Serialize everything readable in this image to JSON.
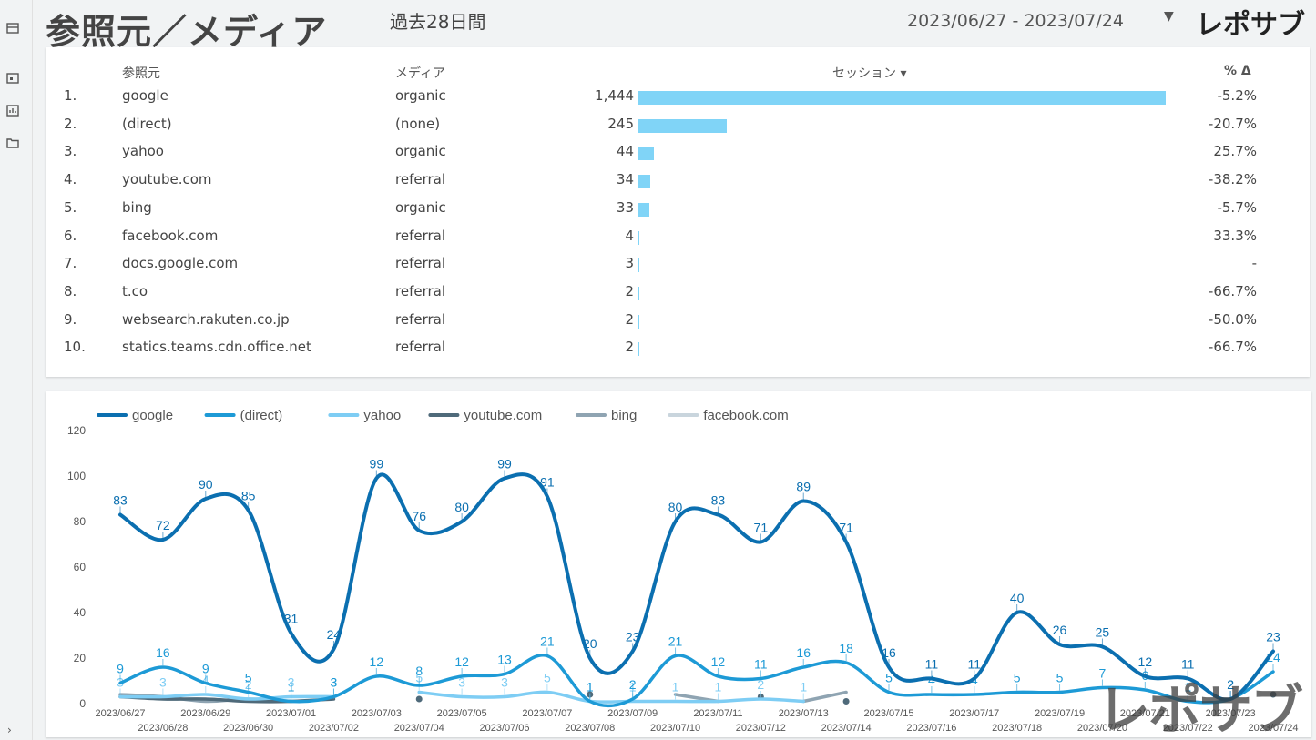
{
  "header": {
    "title": "参照元／メディア",
    "period_label": "過去28日間",
    "date_range": "2023/06/27 - 2023/07/24",
    "brand": "レポサブ"
  },
  "table": {
    "headers": {
      "source": "参照元",
      "medium": "メディア",
      "sessions": "セッション ▾",
      "pct": "% Δ"
    },
    "bar_color": "#80d4f7",
    "max_sessions": 1444,
    "rows": [
      {
        "idx": "1.",
        "source": "google",
        "medium": "organic",
        "sessions": 1444,
        "sessions_label": "1,444",
        "pct": "-5.2%"
      },
      {
        "idx": "2.",
        "source": "(direct)",
        "medium": "(none)",
        "sessions": 245,
        "sessions_label": "245",
        "pct": "-20.7%"
      },
      {
        "idx": "3.",
        "source": "yahoo",
        "medium": "organic",
        "sessions": 44,
        "sessions_label": "44",
        "pct": "25.7%"
      },
      {
        "idx": "4.",
        "source": "youtube.com",
        "medium": "referral",
        "sessions": 34,
        "sessions_label": "34",
        "pct": "-38.2%"
      },
      {
        "idx": "5.",
        "source": "bing",
        "medium": "organic",
        "sessions": 33,
        "sessions_label": "33",
        "pct": "-5.7%"
      },
      {
        "idx": "6.",
        "source": "facebook.com",
        "medium": "referral",
        "sessions": 4,
        "sessions_label": "4",
        "pct": "33.3%"
      },
      {
        "idx": "7.",
        "source": "docs.google.com",
        "medium": "referral",
        "sessions": 3,
        "sessions_label": "3",
        "pct": "-"
      },
      {
        "idx": "8.",
        "source": "t.co",
        "medium": "referral",
        "sessions": 2,
        "sessions_label": "2",
        "pct": "-66.7%"
      },
      {
        "idx": "9.",
        "source": "websearch.rakuten.co.jp",
        "medium": "referral",
        "sessions": 2,
        "sessions_label": "2",
        "pct": "-50.0%"
      },
      {
        "idx": "10.",
        "source": "statics.teams.cdn.office.net",
        "medium": "referral",
        "sessions": 2,
        "sessions_label": "2",
        "pct": "-66.7%"
      }
    ]
  },
  "watermark": "レポサブ",
  "chart_data": {
    "type": "line",
    "x": [
      "2023/06/27",
      "2023/06/28",
      "2023/06/29",
      "2023/06/30",
      "2023/07/01",
      "2023/07/02",
      "2023/07/03",
      "2023/07/04",
      "2023/07/05",
      "2023/07/06",
      "2023/07/07",
      "2023/07/08",
      "2023/07/09",
      "2023/07/10",
      "2023/07/11",
      "2023/07/12",
      "2023/07/13",
      "2023/07/14",
      "2023/07/15",
      "2023/07/16",
      "2023/07/17",
      "2023/07/18",
      "2023/07/19",
      "2023/07/20",
      "2023/07/21",
      "2023/07/22",
      "2023/07/23",
      "2023/07/24"
    ],
    "ylim": [
      0,
      120
    ],
    "yticks": [
      0,
      20,
      40,
      60,
      80,
      100,
      120
    ],
    "grid": false,
    "legend": "top-left",
    "series": [
      {
        "name": "google",
        "color": "#0b6fb0",
        "labels": true,
        "values": [
          83,
          72,
          90,
          85,
          31,
          24,
          99,
          76,
          80,
          99,
          91,
          20,
          23,
          80,
          83,
          71,
          89,
          71,
          16,
          11,
          11,
          40,
          26,
          25,
          12,
          11,
          2,
          23
        ]
      },
      {
        "name": "(direct)",
        "color": "#1d9ad6",
        "labels": true,
        "values": [
          9,
          16,
          9,
          5,
          1,
          3,
          12,
          8,
          12,
          13,
          21,
          1,
          2,
          21,
          12,
          11,
          16,
          18,
          5,
          4,
          4,
          5,
          5,
          7,
          6,
          1,
          2,
          14
        ]
      },
      {
        "name": "yahoo",
        "color": "#7ecdf4",
        "labels": true,
        "values": [
          3,
          3,
          4,
          2,
          3,
          3,
          null,
          5,
          3,
          3,
          5,
          1,
          1,
          1,
          1,
          2,
          1,
          null,
          null,
          null,
          null,
          null,
          null,
          null,
          null,
          null,
          null,
          null
        ]
      },
      {
        "name": "youtube.com",
        "color": "#4f6a7a",
        "labels": false,
        "values": [
          3,
          2,
          2,
          1,
          1,
          2,
          null,
          2,
          null,
          null,
          null,
          4,
          null,
          null,
          null,
          3,
          null,
          1,
          null,
          null,
          null,
          null,
          null,
          null,
          null,
          null,
          null,
          4
        ]
      },
      {
        "name": "bing",
        "color": "#8fa4b2",
        "labels": false,
        "values": [
          4,
          3,
          1,
          2,
          1,
          null,
          null,
          null,
          null,
          null,
          null,
          null,
          null,
          4,
          1,
          null,
          1,
          5,
          null,
          null,
          null,
          null,
          null,
          null,
          null,
          null,
          null,
          null
        ]
      },
      {
        "name": "facebook.com",
        "color": "#c9d5dd",
        "labels": false,
        "values": [
          null,
          null,
          null,
          null,
          null,
          null,
          null,
          null,
          null,
          null,
          null,
          null,
          null,
          null,
          null,
          null,
          null,
          null,
          null,
          null,
          null,
          null,
          null,
          null,
          null,
          null,
          null,
          null
        ]
      }
    ]
  }
}
